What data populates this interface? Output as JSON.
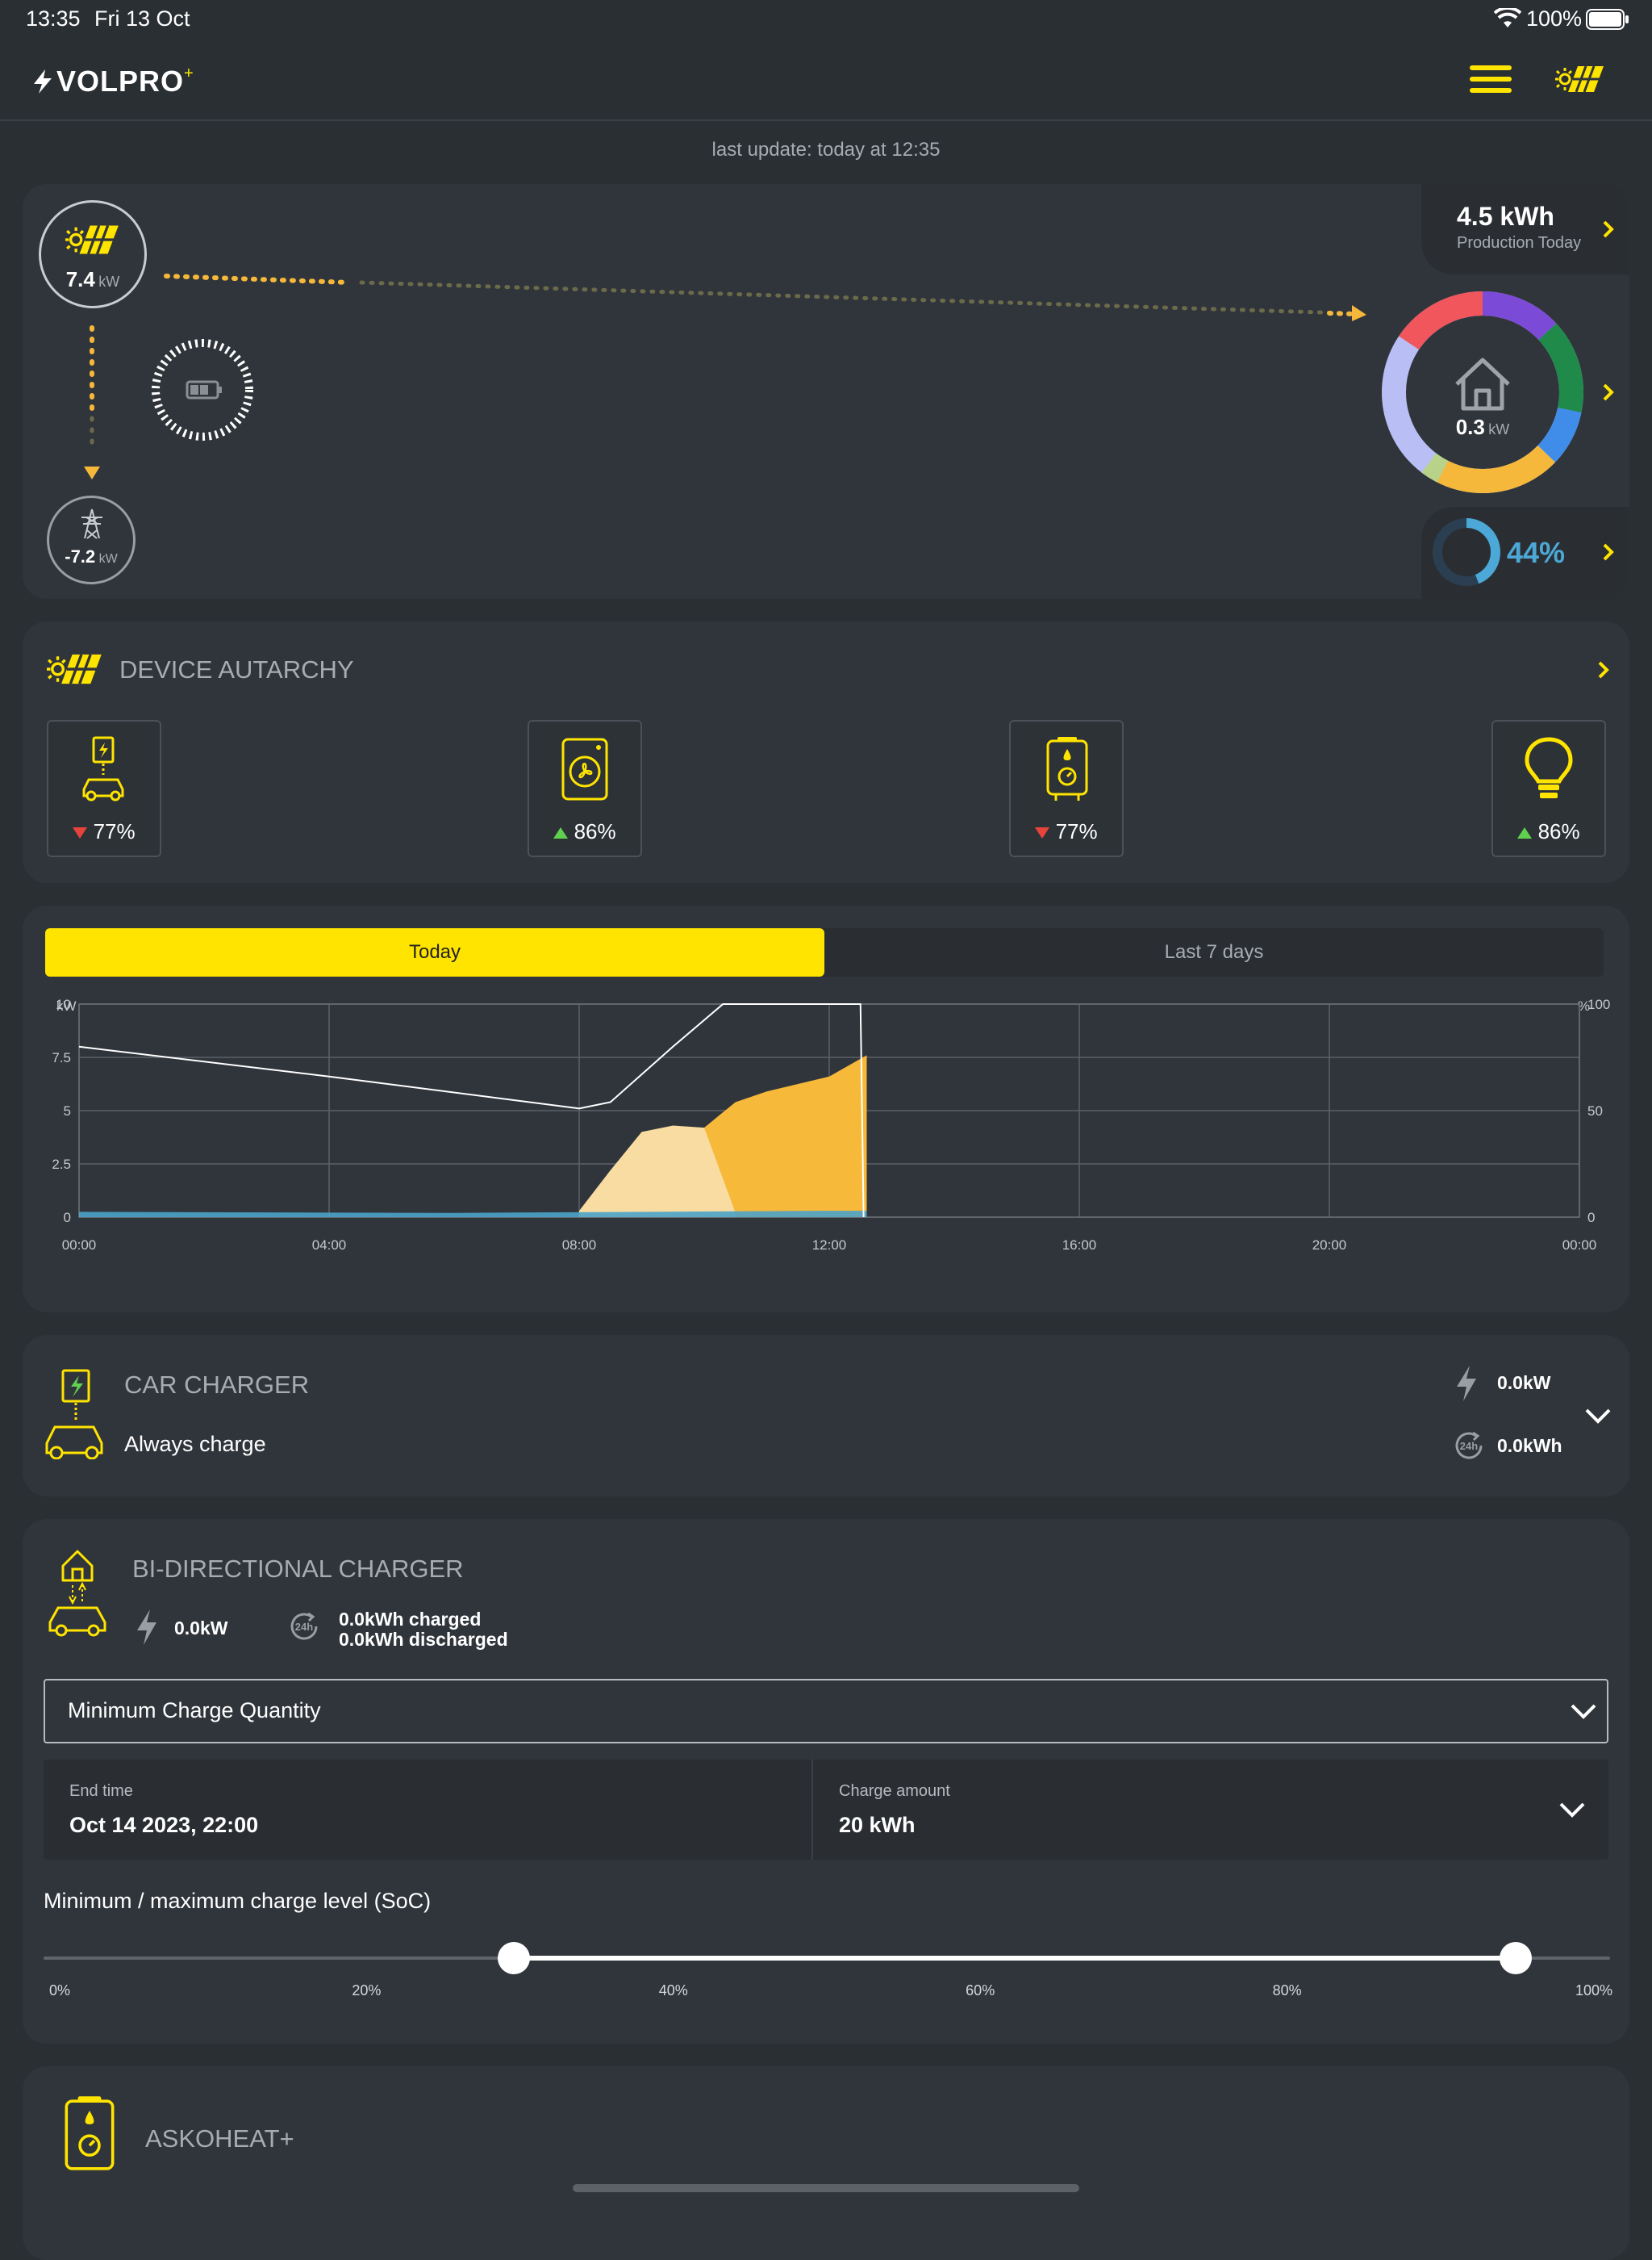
{
  "status_bar": {
    "time": "13:35",
    "date": "Fri 13 Oct",
    "battery": "100%"
  },
  "header": {
    "brand": "VOLPRO",
    "menu_icon": "hamburger-menu-icon",
    "solar_icon": "solar-panel-icon"
  },
  "last_update": "last update: today at 12:35",
  "energy_flow": {
    "solar_value": "7.4",
    "solar_unit": "kW",
    "grid_value": "-7.2",
    "grid_unit": "kW",
    "house_value": "0.3",
    "house_unit": "kW",
    "production_value": "4.5 kWh",
    "production_label": "Production Today",
    "autarchy_percent": "44%",
    "autarchy_level": 0.44
  },
  "device_autarchy": {
    "title": "DEVICE AUTARCHY",
    "devices": [
      {
        "name": "car-charger",
        "value": "77%",
        "trend": "down"
      },
      {
        "name": "heat-pump",
        "value": "86%",
        "trend": "up"
      },
      {
        "name": "water-heater",
        "value": "77%",
        "trend": "down"
      },
      {
        "name": "lighting",
        "value": "86%",
        "trend": "up"
      }
    ]
  },
  "chart_tabs": {
    "today": "Today",
    "last7": "Last 7 days"
  },
  "chart_data": {
    "type": "area",
    "ylabel_left": "kW",
    "ylabel_right": "%",
    "yticks_left": [
      "10",
      "7.5",
      "5",
      "2.5",
      "0"
    ],
    "yticks_right": [
      "100",
      "50",
      "0"
    ],
    "xticks": [
      "00:00",
      "04:00",
      "08:00",
      "12:00",
      "16:00",
      "20:00",
      "00:00"
    ],
    "ylim_left": [
      0,
      10
    ],
    "ylim_right": [
      0,
      100
    ],
    "grid": true,
    "series": [
      {
        "color": "#f7b93a",
        "x": [
          8.2,
          8.6,
          9.2,
          10.0,
          10.5,
          11.0,
          12.0,
          12.6
        ],
        "values": [
          0.3,
          1.5,
          3.8,
          4.2,
          5.4,
          5.9,
          6.6,
          7.6
        ]
      },
      {
        "color": "#f8dca1",
        "x": [
          8.0,
          8.5,
          9.0,
          9.5,
          10.0,
          10.5
        ],
        "values": [
          0.3,
          2.2,
          4.0,
          4.3,
          4.2,
          0.2
        ]
      },
      {
        "color": "#4aa3c9",
        "x": [
          0,
          6,
          12,
          12.6
        ],
        "values": [
          0.25,
          0.2,
          0.3,
          0.3
        ]
      },
      {
        "color": "#ffffff",
        "axis": "right",
        "x": [
          0,
          4,
          8,
          8.5,
          9.5,
          10.3,
          12.5,
          12.55
        ],
        "values": [
          80,
          66,
          51,
          54,
          80,
          100,
          100,
          0
        ]
      }
    ]
  },
  "car_charger": {
    "title": "CAR CHARGER",
    "mode": "Always charge",
    "power": "0.0kW",
    "energy": "0.0kWh"
  },
  "bidir": {
    "title": "BI-DIRECTIONAL CHARGER",
    "power": "0.0kW",
    "charged": "0.0kWh charged",
    "discharged": "0.0kWh discharged",
    "select_value": "Minimum Charge Quantity",
    "end_time_label": "End time",
    "end_time_value": "Oct 14 2023, 22:00",
    "charge_amount_label": "Charge amount",
    "charge_amount_value": "20 kWh",
    "soc_label": "Minimum / maximum charge level (SoC)",
    "soc_min": 0.3,
    "soc_max": 0.94,
    "soc_ticks": [
      "0%",
      "20%",
      "40%",
      "60%",
      "80%",
      "100%"
    ]
  },
  "askoheat": {
    "title": "ASKOHEAT+"
  }
}
